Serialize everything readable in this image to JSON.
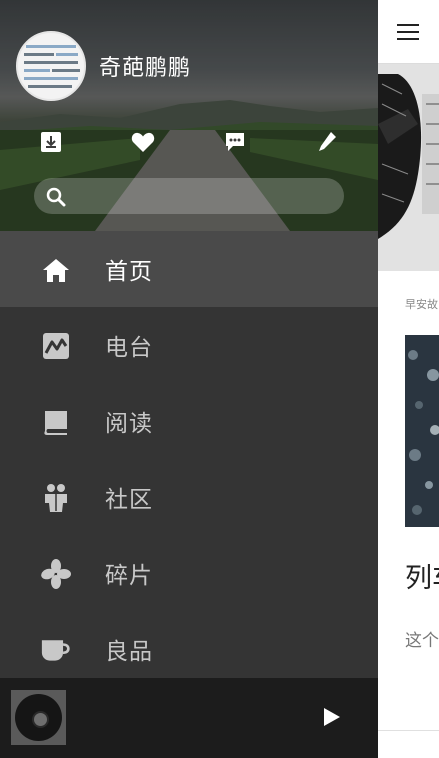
{
  "profile": {
    "username": "奇葩鹏鹏"
  },
  "header_actions": [
    {
      "icon": "download-icon"
    },
    {
      "icon": "heart-icon"
    },
    {
      "icon": "message-icon"
    },
    {
      "icon": "pencil-icon"
    }
  ],
  "search": {
    "icon": "search-icon",
    "placeholder": ""
  },
  "menu": [
    {
      "label": "首页",
      "icon": "home-icon",
      "active": true
    },
    {
      "label": "电台",
      "icon": "radio-icon",
      "active": false
    },
    {
      "label": "阅读",
      "icon": "book-icon",
      "active": false
    },
    {
      "label": "社区",
      "icon": "community-icon",
      "active": false
    },
    {
      "label": "碎片",
      "icon": "clover-icon",
      "active": false
    },
    {
      "label": "良品",
      "icon": "cup-icon",
      "active": false
    }
  ],
  "player": {
    "disc_icon": "vinyl-disc-icon",
    "play_icon": "play-icon"
  },
  "main": {
    "menu_icon": "hamburger-icon",
    "category": "早安故",
    "article_title": "列车",
    "excerpt": "这个"
  },
  "colors": {
    "drawer_bg": "#343434",
    "active_item_bg": "#4a4a4a",
    "player_bg": "#1c1c1c",
    "main_bg": "#ffffff"
  }
}
